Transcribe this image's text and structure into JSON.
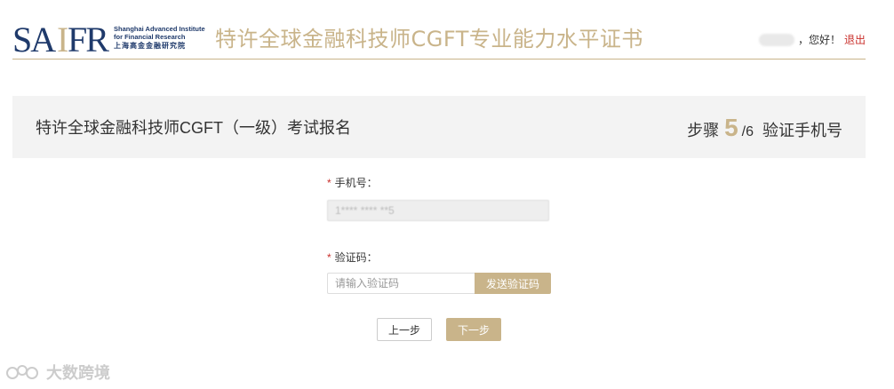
{
  "header": {
    "logo_en_line1": "Shanghai Advanced Institute",
    "logo_en_line2": "for Financial Research",
    "logo_cn": "上海高金金融研究院",
    "site_title": "特许全球金融科技师CGFT专业能力水平证书",
    "greeting": "，您好！",
    "logout_label": "退出"
  },
  "step_bar": {
    "exam_title": "特许全球金融科技师CGFT（一级）考试报名",
    "step_prefix": "步骤",
    "step_current": "5",
    "step_total": "/6",
    "step_name": "验证手机号"
  },
  "form": {
    "phone_label": "手机号：",
    "phone_value": "1**** **** **5",
    "code_label": "验证码：",
    "code_placeholder": "请输入验证码",
    "send_code_label": "发送验证码",
    "prev_label": "上一步",
    "next_label": "下一步",
    "required_mark": "*"
  },
  "watermark": {
    "text": "大数跨境"
  },
  "colors": {
    "accent": "#c9b48a",
    "brand_blue": "#1f3a6b",
    "required": "#c9302c"
  }
}
